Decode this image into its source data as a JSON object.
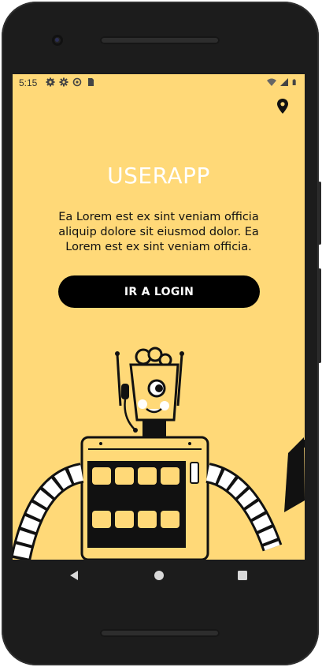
{
  "status_bar": {
    "time": "5:15",
    "left_icons": [
      "gear-icon",
      "gear-icon",
      "sync-icon",
      "sim-card-icon"
    ],
    "right_icons": [
      "wifi-icon",
      "signal-icon",
      "battery-icon"
    ]
  },
  "header": {
    "location_icon": "location-pin-icon"
  },
  "main": {
    "title": "USERAPP",
    "description": "Ea Lorem est ex sint veniam officia aliquip dolore sit eiusmod dolor. Ea Lorem est ex sint veniam officia.",
    "login_button_label": "IR A LOGIN"
  },
  "illustration": {
    "name": "robot-illustration"
  },
  "navigation_bar": {
    "buttons": [
      "back-icon",
      "home-icon",
      "recents-icon"
    ]
  },
  "colors": {
    "background": "#ffd978",
    "title": "#ffffff",
    "button": "#000000",
    "button_text": "#ffffff"
  }
}
